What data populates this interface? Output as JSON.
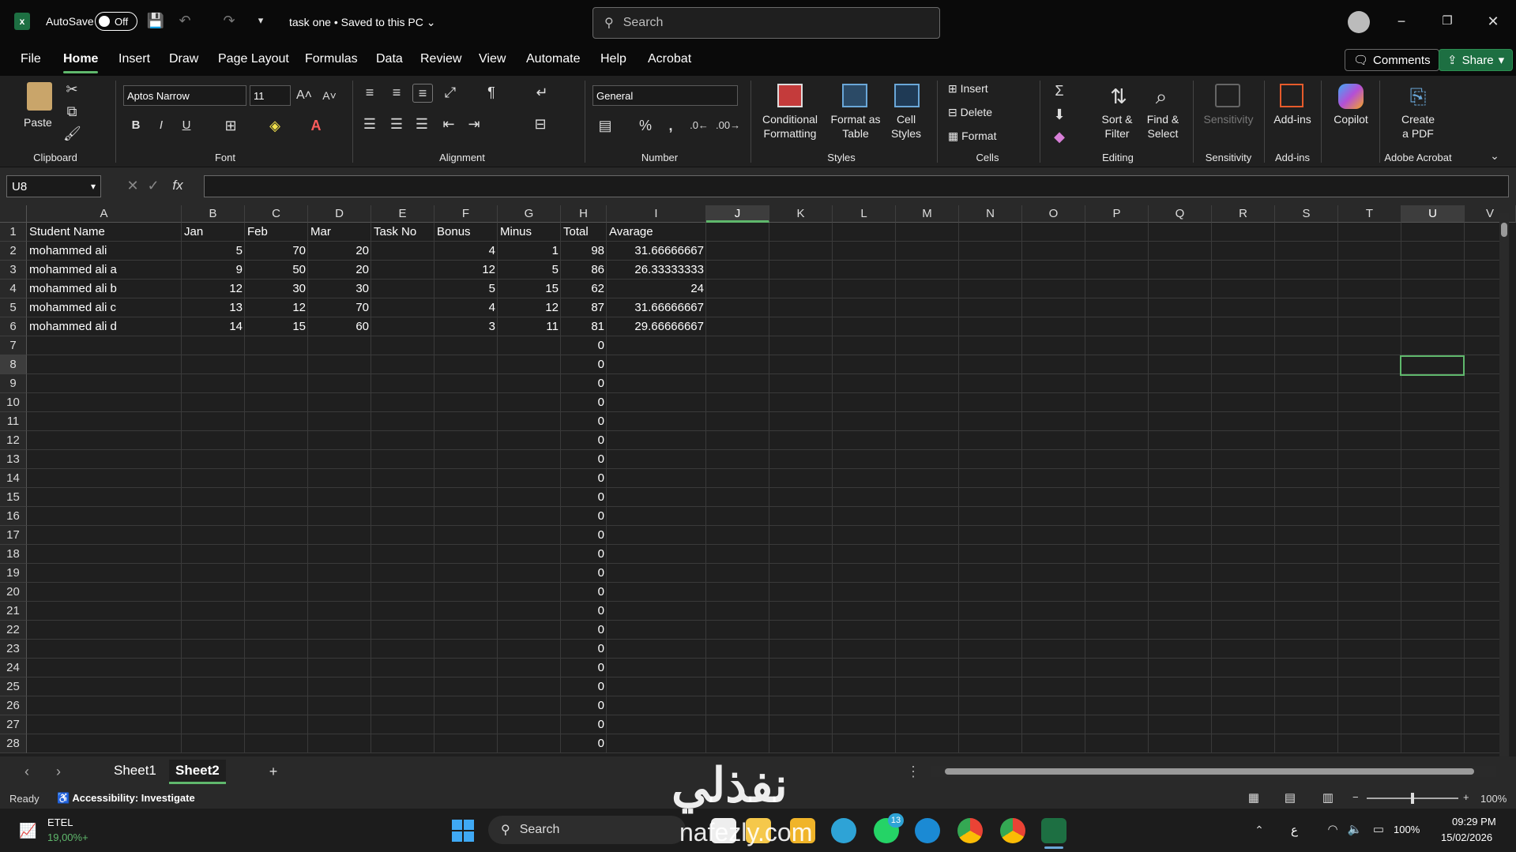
{
  "titlebar": {
    "autosave_label": "AutoSave",
    "autosave_state": "Off",
    "doc_title": "task one • Saved to this PC",
    "search_placeholder": "Search"
  },
  "menu": {
    "items": [
      "File",
      "Home",
      "Insert",
      "Draw",
      "Page Layout",
      "Formulas",
      "Data",
      "Review",
      "View",
      "Automate",
      "Help",
      "Acrobat"
    ],
    "active": "Home",
    "comments_label": "Comments",
    "share_label": "Share"
  },
  "ribbon": {
    "clipboard": {
      "paste": "Paste",
      "group": "Clipboard"
    },
    "font": {
      "name": "Aptos Narrow",
      "size": "11",
      "bold": "B",
      "italic": "I",
      "underline": "U",
      "group": "Font"
    },
    "alignment": {
      "group": "Alignment"
    },
    "number": {
      "format": "General",
      "group": "Number"
    },
    "styles": {
      "conditional": "Conditional",
      "conditional2": "Formatting",
      "format_table": "Format as",
      "format_table2": "Table",
      "cell_styles": "Cell",
      "cell_styles2": "Styles",
      "group": "Styles"
    },
    "cells": {
      "insert": "Insert",
      "delete": "Delete",
      "format": "Format",
      "group": "Cells"
    },
    "editing": {
      "sort": "Sort &",
      "sort2": "Filter",
      "find": "Find &",
      "find2": "Select",
      "group": "Editing"
    },
    "sensitivity": {
      "label": "Sensitivity",
      "group": "Sensitivity"
    },
    "addins": {
      "label": "Add-ins",
      "group": "Add-ins"
    },
    "copilot": {
      "label": "Copilot"
    },
    "acrobat": {
      "create": "Create",
      "create2": "a PDF",
      "group": "Adobe Acrobat"
    }
  },
  "formula_bar": {
    "name_box": "U8",
    "fx": "fx",
    "formula": ""
  },
  "sheet": {
    "columns": [
      "A",
      "B",
      "C",
      "D",
      "E",
      "F",
      "G",
      "H",
      "I",
      "J",
      "K",
      "L",
      "M",
      "N",
      "O",
      "P",
      "Q",
      "R",
      "S",
      "T",
      "U",
      "V"
    ],
    "rows_visible": [
      "1",
      "2",
      "3",
      "4",
      "5",
      "6",
      "7",
      "8",
      "9",
      "10",
      "11",
      "12",
      "13",
      "14",
      "15",
      "16",
      "17",
      "18",
      "19",
      "20",
      "21",
      "22",
      "23",
      "24",
      "25",
      "26",
      "27",
      "28"
    ],
    "headers": [
      "Student Name",
      "Jan",
      "Feb",
      "Mar",
      "Task No",
      "Bonus",
      "Minus",
      "Total",
      "Avarage"
    ],
    "data": [
      [
        "mohammed ali",
        "5",
        "70",
        "20",
        "",
        "4",
        "1",
        "98",
        "31.66666667"
      ],
      [
        "mohammed ali a",
        "9",
        "50",
        "20",
        "",
        "12",
        "5",
        "86",
        "26.33333333"
      ],
      [
        "mohammed ali b",
        "12",
        "30",
        "30",
        "",
        "5",
        "15",
        "62",
        "24"
      ],
      [
        "mohammed ali c",
        "13",
        "12",
        "70",
        "",
        "4",
        "12",
        "87",
        "31.66666667"
      ],
      [
        "mohammed ali d",
        "14",
        "15",
        "60",
        "",
        "3",
        "11",
        "81",
        "29.66666667"
      ]
    ],
    "zero_total": "0",
    "selected_cell": "U8"
  },
  "tabs": {
    "sheets": [
      "Sheet1",
      "Sheet2"
    ],
    "active": "Sheet2",
    "add": "+"
  },
  "status": {
    "ready": "Ready",
    "accessibility": "Accessibility: Investigate",
    "zoom": "100%",
    "zoom_minus": "−",
    "zoom_plus": "+"
  },
  "taskbar": {
    "stock_name": "ETEL",
    "stock_change": "19,00%+",
    "search": "Search",
    "whatsapp_badge": "13",
    "lang": "ع",
    "battery": "100%",
    "time": "09:29 PM",
    "date": "15/02/2026"
  },
  "watermark": {
    "text": "نفذلي",
    "url": "nafezly.com"
  },
  "colors": {
    "accent": "#5fb86c",
    "excel_green": "#1d6f42",
    "cell_bg": "#1f1f1f"
  }
}
